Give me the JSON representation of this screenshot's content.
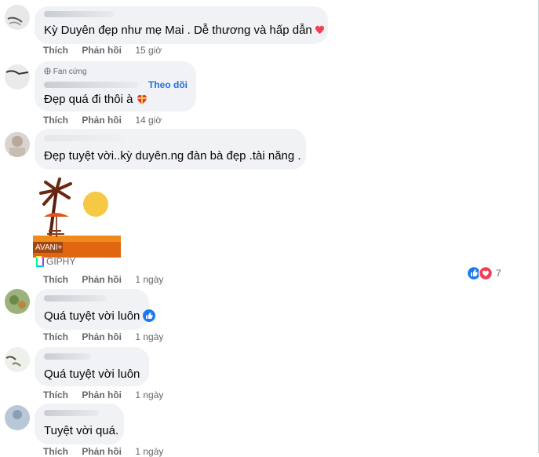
{
  "comments": [
    {
      "text": "Kỳ Duyên đẹp như mẹ Mai . Dễ thương và hấp dẫn",
      "actions": {
        "like": "Thích",
        "reply": "Phản hồi",
        "time": "15 giờ"
      }
    },
    {
      "badge": "Fan cứng",
      "follow": "Theo dõi",
      "text": "Đẹp quá đi thôi à",
      "actions": {
        "like": "Thích",
        "reply": "Phản hồi",
        "time": "14 giờ"
      }
    },
    {
      "text": "Đẹp tuyệt vời..kỳ duyên.ng đàn bà đẹp .tài năng .",
      "gif_label": "AVANI+",
      "giphy": "GIPHY",
      "reactions_count": "7",
      "actions": {
        "like": "Thích",
        "reply": "Phản hồi",
        "time": "1 ngày"
      }
    },
    {
      "text": "Quá tuyệt vời luôn",
      "actions": {
        "like": "Thích",
        "reply": "Phản hồi",
        "time": "1 ngày"
      }
    },
    {
      "text": "Quá tuyệt vời luôn",
      "actions": {
        "like": "Thích",
        "reply": "Phản hồi",
        "time": "1 ngày"
      }
    },
    {
      "text": "Tuyệt vời quá.",
      "actions": {
        "like": "Thích",
        "reply": "Phản hồi",
        "time": "1 ngày"
      }
    }
  ],
  "colors": {
    "bubble": "#f0f2f5",
    "link": "#216fdb",
    "meta": "#65676b",
    "like_blue": "#1877f2",
    "heart_red": "#f33e58"
  },
  "icons": [
    "heart-emoji",
    "gift-heart-emoji",
    "like-reaction-icon",
    "love-reaction-icon",
    "giphy-logo-icon",
    "globe-icon"
  ]
}
